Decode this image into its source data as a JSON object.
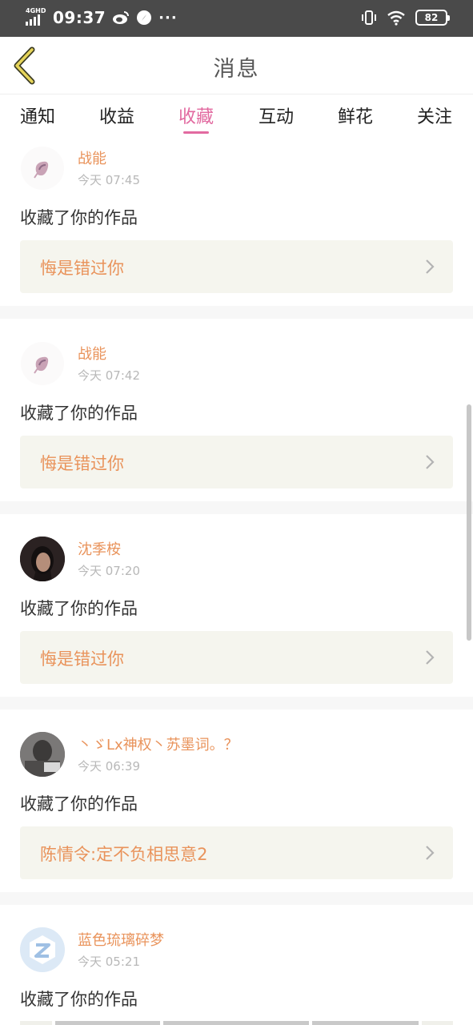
{
  "status_bar": {
    "network": "4GHD",
    "time": "09:37",
    "dots": "···",
    "battery": "82"
  },
  "header": {
    "title": "消息"
  },
  "tabs": [
    {
      "label": "通知"
    },
    {
      "label": "收益"
    },
    {
      "label": "收藏"
    },
    {
      "label": "互动"
    },
    {
      "label": "鲜花"
    },
    {
      "label": "关注"
    }
  ],
  "active_tab": "收藏",
  "messages": [
    {
      "user": "战能",
      "time": "今天 07:45",
      "action": "收藏了你的作品",
      "work": "悔是错过你"
    },
    {
      "user": "战能",
      "time": "今天 07:42",
      "action": "收藏了你的作品",
      "work": "悔是错过你"
    },
    {
      "user": "沈季桉",
      "time": "今天 07:20",
      "action": "收藏了你的作品",
      "work": "悔是错过你"
    },
    {
      "user": "丶ゞLx神权丶苏墨词。？",
      "time": "今天 06:39",
      "action": "收藏了你的作品",
      "work": "陈情令:定不负相思意2"
    },
    {
      "user": "蓝色琉璃碎梦",
      "time": "今天 05:21",
      "action": "收藏了你的作品",
      "work": ""
    }
  ],
  "colors": {
    "accent_pink": "#e26aa0",
    "username_orange": "#e9935b",
    "work_box_bg": "#f5f5ee",
    "status_bar_bg": "#4a4a4a"
  }
}
